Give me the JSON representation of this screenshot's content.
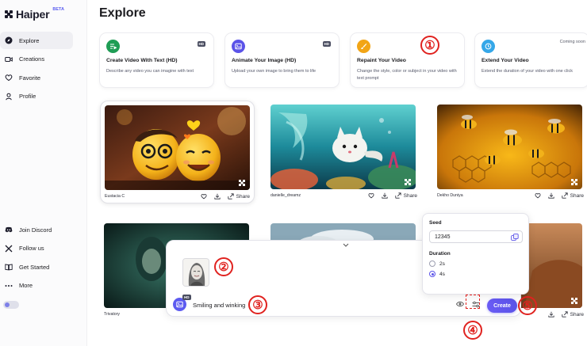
{
  "brand": {
    "name": "Haiper",
    "badge": "BETA"
  },
  "sidebar": {
    "items": [
      {
        "label": "Explore",
        "icon": "compass-icon",
        "active": true
      },
      {
        "label": "Creations",
        "icon": "video-icon"
      },
      {
        "label": "Favorite",
        "icon": "heart-icon"
      },
      {
        "label": "Profile",
        "icon": "user-icon"
      }
    ],
    "bottom_items": [
      {
        "label": "Join Discord",
        "icon": "discord-icon"
      },
      {
        "label": "Follow us",
        "icon": "x-icon"
      },
      {
        "label": "Get Started",
        "icon": "book-icon"
      },
      {
        "label": "More",
        "icon": "more-icon"
      }
    ]
  },
  "page": {
    "title": "Explore"
  },
  "feature_cards": [
    {
      "title": "Create Video With Text (HD)",
      "desc": "Describe any video you can imagine with text",
      "badge": "HD",
      "icon": "text-to-video-icon",
      "color": "#1f9d55"
    },
    {
      "title": "Animate Your Image (HD)",
      "desc": "Upload your own image to bring them to life",
      "badge": "HD",
      "icon": "image-icon",
      "color": "#5b53e8"
    },
    {
      "title": "Repaint Your Video",
      "desc": "Change the style, color or subject in your video with text prompt",
      "badge": "",
      "icon": "brush-icon",
      "color": "#f2a516"
    },
    {
      "title": "Extend Your Video",
      "desc": "Extend the duration of your video with one click",
      "badge": "Coming soon",
      "icon": "clock-icon",
      "color": "#35a7e8"
    }
  ],
  "videos": [
    {
      "author": "Eustacia C",
      "share": "Share"
    },
    {
      "author": "danielle_dreamz",
      "share": "Share"
    },
    {
      "author": "Dekho Duniya",
      "share": "Share"
    },
    {
      "author": "Trivatory",
      "share": "Share"
    }
  ],
  "prompt": {
    "text": "Smiling and winking",
    "badge": "HD",
    "create_label": "Create"
  },
  "settings": {
    "seed_label": "Seed",
    "seed_value": "12345",
    "duration_label": "Duration",
    "duration_options": [
      "2s",
      "4s"
    ],
    "duration_selected": "4s"
  },
  "annotations": [
    "①",
    "②",
    "③",
    "④",
    "⑤"
  ],
  "colors": {
    "accent": "#5b53e8",
    "annotation": "#e0221f"
  }
}
